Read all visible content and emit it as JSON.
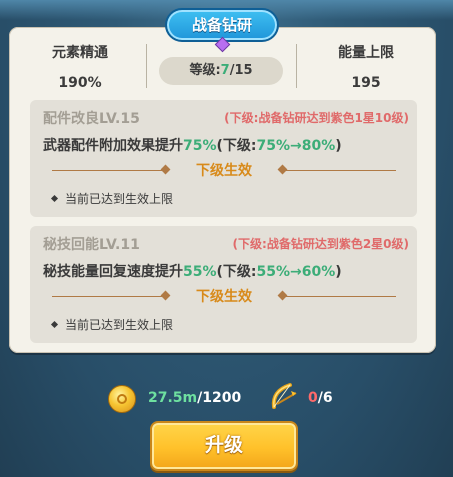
{
  "title": "战备钻研",
  "stats": {
    "left": {
      "label": "元素精通",
      "value": "190%"
    },
    "right": {
      "label": "能量上限",
      "value": "195"
    },
    "level": {
      "prefix": "等级:",
      "current": "7",
      "max": "/15"
    }
  },
  "cards": [
    {
      "name": "配件改良LV.15",
      "requirement": "(下级:战备钻研达到紫色1星10级)",
      "desc_text": "武器配件附加效果提升",
      "desc_value": "75%",
      "desc_next_prefix": "(下级:",
      "desc_next_from": "75%",
      "desc_arrow": "→",
      "desc_next_to": "80%",
      "desc_close": ")",
      "next_label": "下级生效",
      "note": "当前已达到生效上限"
    },
    {
      "name": "秘技回能LV.11",
      "requirement": "(下级:战备钻研达到紫色2星0级)",
      "desc_text": "秘技能量回复速度提升",
      "desc_value": "55%",
      "desc_next_prefix": "(下级:",
      "desc_next_from": "55%",
      "desc_arrow": "→",
      "desc_next_to": "60%",
      "desc_close": ")",
      "next_label": "下级生效",
      "note": "当前已达到生效上限"
    }
  ],
  "costs": {
    "coin": {
      "icon": "gold-coin-icon",
      "have": "27.5m",
      "need": "/1200"
    },
    "bow": {
      "icon": "golden-bow-icon",
      "have": "0",
      "need": "/6"
    }
  },
  "upgrade_button": "升级",
  "colors": {
    "accent_green": "#3cad78",
    "requirement_red": "#e06a6a",
    "next_effect_orange": "#d88a1a",
    "title_blue": "#1f95d9",
    "button_yellow": "#ffc12a"
  }
}
